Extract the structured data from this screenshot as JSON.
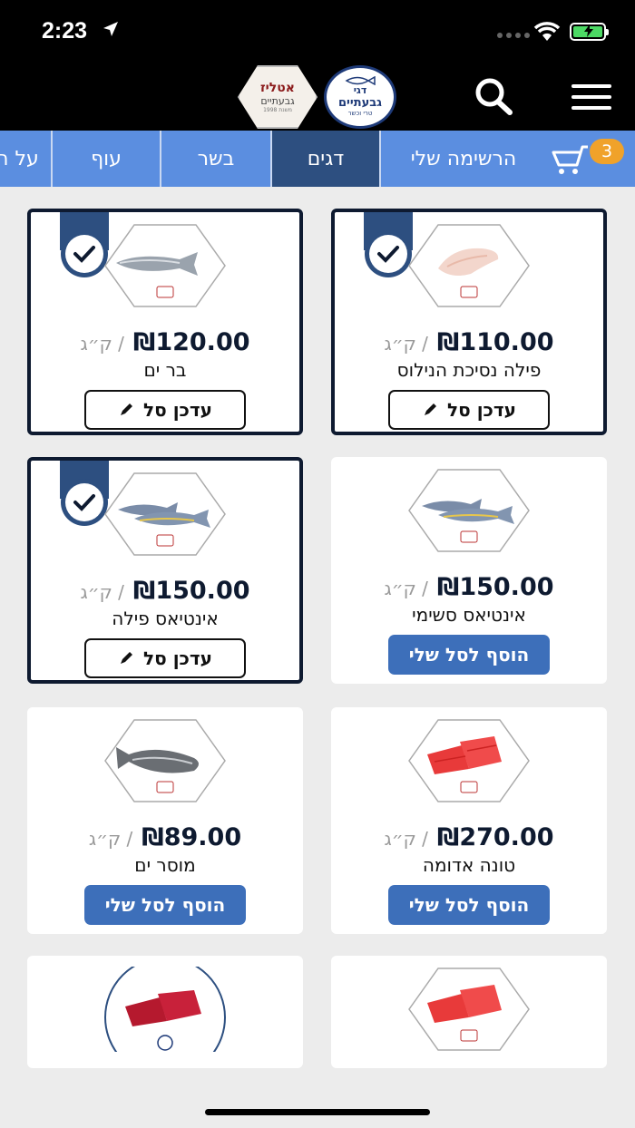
{
  "status": {
    "time": "2:23"
  },
  "header": {
    "logo_fish": {
      "line1": "דגי",
      "line2": "גבעתיים",
      "line3": "טרי וכשר"
    },
    "logo_butcher": {
      "line1": "אטליז",
      "line2": "גבעתיים",
      "line3": "משנת 1998"
    }
  },
  "tabs": {
    "my_list": "הרשימה שלי",
    "items": [
      "דגים",
      "בשר",
      "עוף",
      "על ה"
    ],
    "active": "דגים",
    "cart_count": "3"
  },
  "products": [
    {
      "name": "פילה נסיכת הנילוס",
      "price": "₪110.00",
      "unit": "ק״ג",
      "button": "עדכן סל",
      "selected": true
    },
    {
      "name": "בר ים",
      "price": "₪120.00",
      "unit": "ק״ג",
      "button": "עדכן סל",
      "selected": true
    },
    {
      "name": "אינטיאס סשימי",
      "price": "₪150.00",
      "unit": "ק״ג",
      "button": "הוסף לסל שלי",
      "selected": false
    },
    {
      "name": "אינטיאס פילה",
      "price": "₪150.00",
      "unit": "ק״ג",
      "button": "עדכן סל",
      "selected": true
    },
    {
      "name": "טונה אדומה",
      "price": "₪270.00",
      "unit": "ק״ג",
      "button": "הוסף לסל שלי",
      "selected": false
    },
    {
      "name": "מוסר ים",
      "price": "₪89.00",
      "unit": "ק״ג",
      "button": "הוסף לסל שלי",
      "selected": false
    }
  ],
  "colors": {
    "accent": "#3d6fba",
    "tabs_bg": "#5b8ee0",
    "tab_active": "#2d4f80",
    "badge": "#f0a22a",
    "dark": "#0e1a30"
  }
}
